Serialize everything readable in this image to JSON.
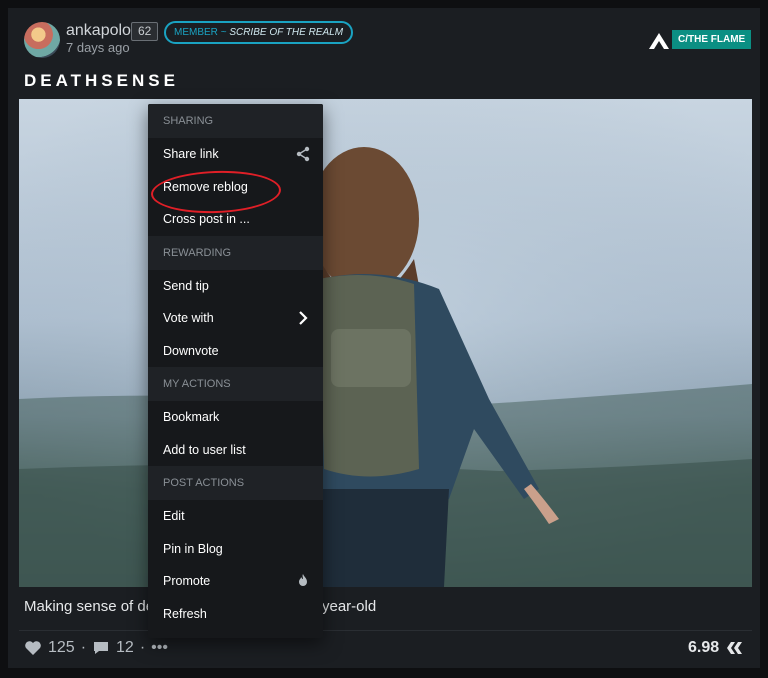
{
  "author": {
    "name": "ankapolo",
    "reputation": "62",
    "badge_role": "MEMBER",
    "badge_sep": "~",
    "badge_title": "SCRIBE OF THE REALM",
    "time_ago": "7 days ago"
  },
  "community": {
    "tag": "C/THE FLAME"
  },
  "post": {
    "title": "DEATHSENSE",
    "summary_left": "Making sense of de",
    "summary_right": "year-old"
  },
  "stats": {
    "likes": "125",
    "comments": "12",
    "payout": "6.98"
  },
  "menu": {
    "sections": [
      {
        "header": "SHARING",
        "items": [
          "Share link",
          "Remove reblog",
          "Cross post in ..."
        ]
      },
      {
        "header": "REWARDING",
        "items": [
          "Send tip",
          "Vote with",
          "Downvote"
        ]
      },
      {
        "header": "MY ACTIONS",
        "items": [
          "Bookmark",
          "Add to user list"
        ]
      },
      {
        "header": "POST ACTIONS",
        "items": [
          "Edit",
          "Pin in Blog",
          "Promote",
          "Refresh"
        ]
      }
    ]
  },
  "colors": {
    "badge": "#1aa3c2",
    "community_tag": "#0b8f83",
    "annotation": "#e01f27"
  }
}
